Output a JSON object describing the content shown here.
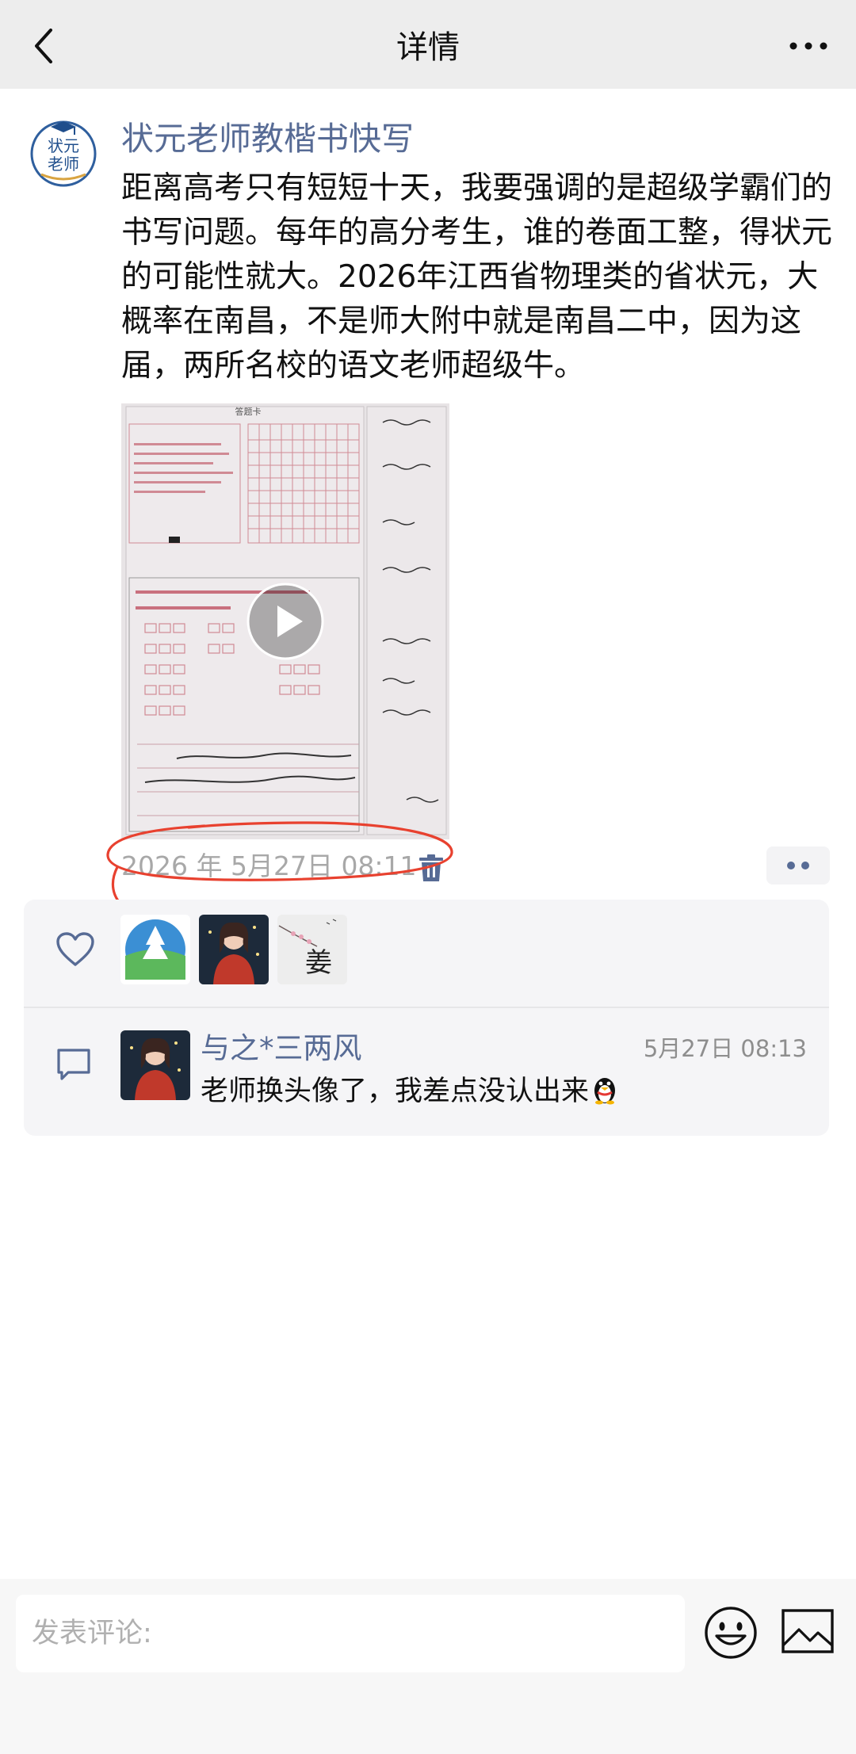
{
  "header": {
    "title": "详情",
    "back_icon": "chevron-left-icon",
    "more_icon": "ellipsis-icon"
  },
  "post": {
    "author": "状元老师教楷书快写",
    "avatar_text_top": "状元",
    "avatar_text_bottom": "老师",
    "text": "距离高考只有短短十天，我要强调的是超级学霸们的书写问题。每年的高分考生，谁的卷面工整，得状元的可能性就大。2026年江西省物理类的省状元，大概率在南昌，不是师大附中就是南昌二中，因为这届，两所名校的语文老师超级牛。",
    "media": {
      "type": "video",
      "sheet_title": "答题卡",
      "play_icon": "play-icon"
    },
    "timestamp": "2026 年 5月27日  08:11",
    "delete_icon": "trash-icon"
  },
  "likes": {
    "icon": "heart-icon",
    "users": [
      {
        "name": "liker-1",
        "tile_text": ""
      },
      {
        "name": "liker-2",
        "tile_text": ""
      },
      {
        "name": "liker-3",
        "tile_text": "姜"
      }
    ]
  },
  "comments": [
    {
      "name": "与之*三两风",
      "time": "5月27日 08:13",
      "text": "老师换头像了，我差点没认出来"
    }
  ],
  "composer": {
    "placeholder": "发表评论:",
    "emoji_icon": "smiley-icon",
    "image_icon": "image-icon"
  },
  "colors": {
    "link": "#576b95",
    "header_bg": "#ededed",
    "annotation": "#e8412f"
  }
}
